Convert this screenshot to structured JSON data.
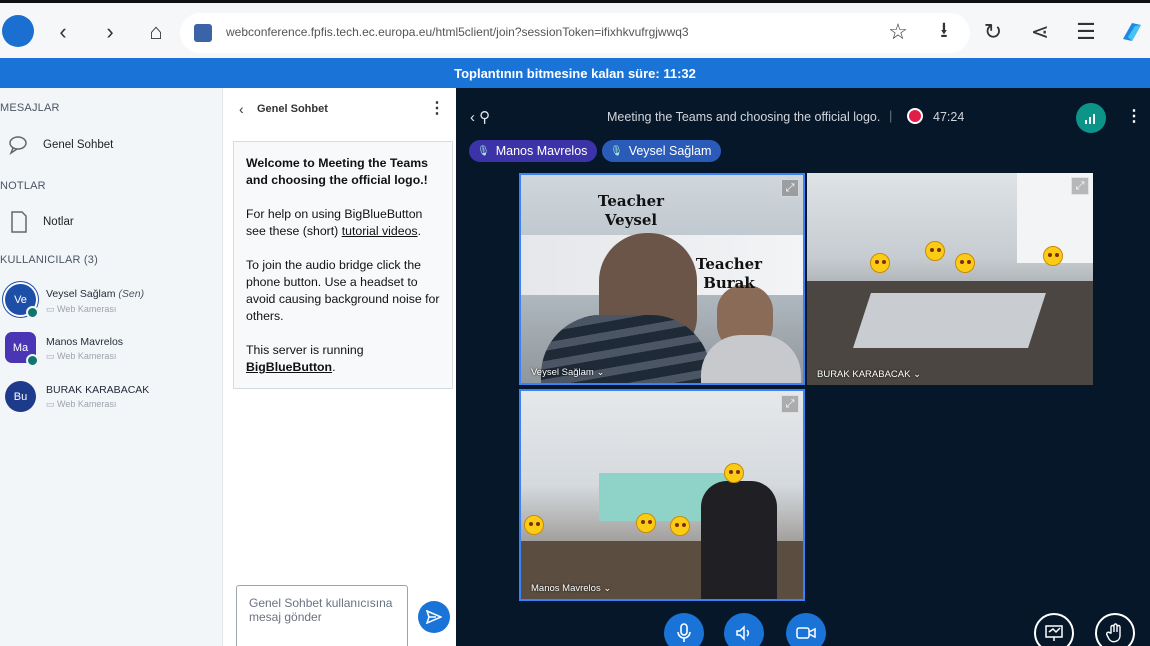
{
  "browser": {
    "url": "webconference.fpfis.tech.ec.europa.eu/html5client/join?sessionToken=ifixhkvufrgjwwq3"
  },
  "timer": {
    "text": "Toplantının bitmesine kalan süre: 11:32"
  },
  "sidebar": {
    "messages_title": "MESAJLAR",
    "public_chat_label": "Genel Sohbet",
    "notes_title": "NOTLAR",
    "notes_label": "Notlar",
    "users_title": "KULLANICILAR (3)",
    "users": [
      {
        "initials": "Ve",
        "name": "Veysel Sağlam",
        "you_tag": "(Sen)",
        "sub": "Web Kamerası",
        "color": "#1e4fa8"
      },
      {
        "initials": "Ma",
        "name": "Manos Mavrelos",
        "you_tag": "",
        "sub": "Web Kamerası",
        "color": "#4a35b5"
      },
      {
        "initials": "Bu",
        "name": "BURAK KARABACAK",
        "you_tag": "",
        "sub": "Web Kamerası",
        "color": "#1e3a8a"
      }
    ]
  },
  "chat": {
    "title": "Genel Sohbet",
    "welcome_line1": "Welcome to Meeting the Teams and choosing the official logo.!",
    "welcome_help_prefix": "For help on using BigBlueButton see these (short) ",
    "welcome_help_link": "tutorial videos",
    "welcome_help_suffix": ".",
    "welcome_audio": "To join the audio bridge click the phone button. Use a headset to avoid causing background noise for others.",
    "welcome_server_prefix": "This server is running ",
    "welcome_server_link": "BigBlueButton",
    "welcome_server_suffix": ".",
    "input_placeholder": "Genel Sohbet kullanıcısına mesaj gönder"
  },
  "meeting": {
    "title": "Meeting the Teams and choosing the official logo.",
    "separator": "|",
    "recording_time": "47:24",
    "talkers": [
      "Manos Mavrelos",
      "Veysel Sağlam"
    ],
    "tiles": [
      {
        "name": "Veysel Sağlam",
        "overlay_1": "Teacher\nVeysel",
        "overlay_2": "Teacher\nBurak"
      },
      {
        "name": "BURAK KARABACAK"
      },
      {
        "name": "Manos Mavrelos"
      }
    ]
  },
  "colors": {
    "accent": "#1a74d8",
    "meeting_bg": "#06172a",
    "talker_a": "#3d33a8",
    "talker_b": "#2b5bb8"
  }
}
